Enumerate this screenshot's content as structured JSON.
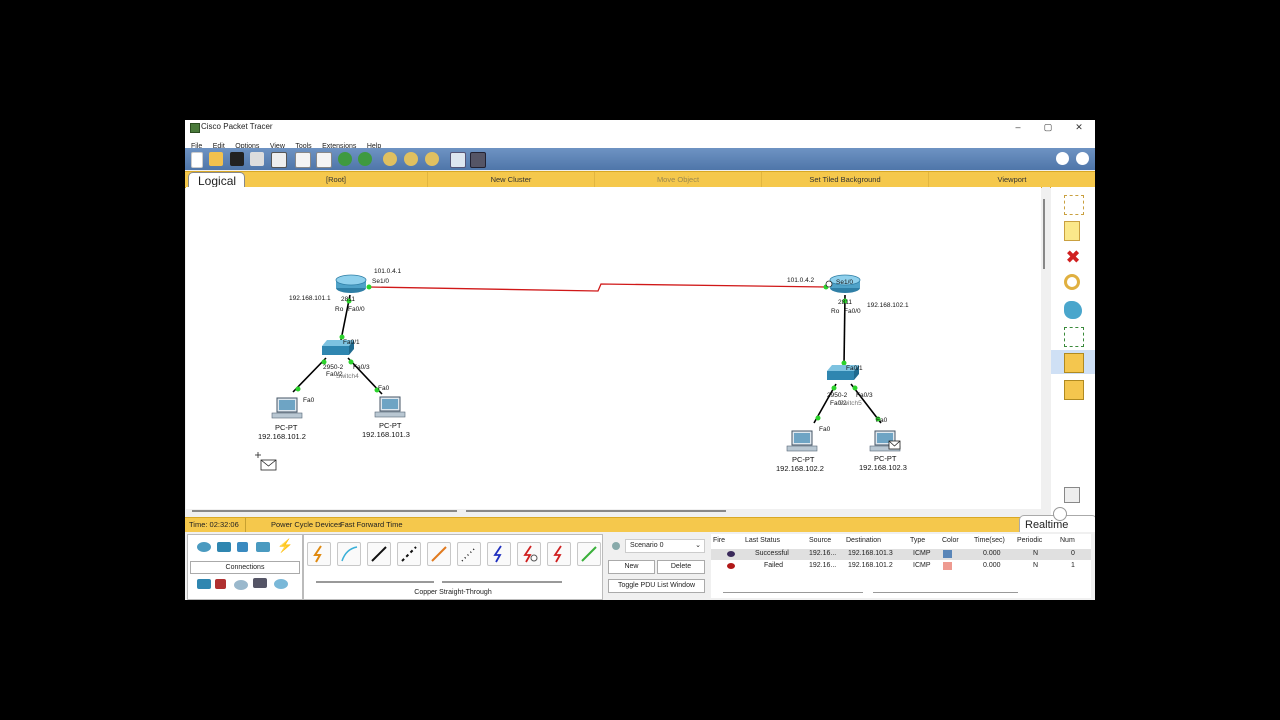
{
  "window": {
    "title": "Cisco Packet Tracer"
  },
  "menu": [
    "File",
    "Edit",
    "Options",
    "View",
    "Tools",
    "Extensions",
    "Help"
  ],
  "window_controls": {
    "minimize": "–",
    "maximize": "▢",
    "close": "✕"
  },
  "workspace": {
    "logical_tab": "Logical"
  },
  "nav": {
    "root": "[Root]",
    "new_cluster": "New Cluster",
    "move_object": "Move Object",
    "set_tiled_background": "Set Tiled Background",
    "viewport": "Viewport"
  },
  "topology": {
    "router1": {
      "model": "2811",
      "name_prefix": "Ro",
      "fa_label": "Fa0/0",
      "se_label": "Se1/0",
      "se_ip": "101.0.4.1",
      "lan_ip": "192.168.101.1"
    },
    "router2": {
      "model": "2811",
      "name_prefix": "Ro",
      "fa_label": "Fa0/0",
      "se_label": "Se1/0",
      "se_ip": "101.0.4.2",
      "lan_ip": "192.168.102.1"
    },
    "switch1": {
      "model": "2950-2",
      "port_up": "Fa0/1",
      "port_left": "Fa0/2",
      "port_right": "Fa0/3",
      "overlap": "Switch4"
    },
    "switch2": {
      "model": "2950-2",
      "port_up": "Fa0/1",
      "port_left": "Fa0/2",
      "port_right": "Fa0/3",
      "overlap": "Switch5"
    },
    "pcs": [
      {
        "type": "PC-PT",
        "ip": "192.168.101.2",
        "port": "Fa0"
      },
      {
        "type": "PC-PT",
        "ip": "192.168.101.3",
        "port": "Fa0"
      },
      {
        "type": "PC-PT",
        "ip": "192.168.102.2",
        "port": "Fa0"
      },
      {
        "type": "PC-PT",
        "ip": "192.168.102.3",
        "port": "Fa0"
      }
    ]
  },
  "status": {
    "time": "Time: 02:32:06",
    "power_cycle": "Power Cycle Devices",
    "fast_forward": "Fast Forward Time",
    "mode": "Realtime"
  },
  "devices": {
    "category_label": "Connections"
  },
  "cables": {
    "selected_name": "Copper Straight-Through"
  },
  "scenario": {
    "selected": "Scenario 0",
    "new": "New",
    "delete": "Delete",
    "toggle": "Toggle PDU List Window"
  },
  "pdu_table": {
    "headers": [
      "Fire",
      "Last Status",
      "Source",
      "Destination",
      "Type",
      "Color",
      "Time(sec)",
      "Periodic",
      "Num"
    ],
    "rows": [
      {
        "status": "Successful",
        "source": "192.16...",
        "destination": "192.168.101.3",
        "type": "ICMP",
        "color": "#5a86b8",
        "time": "0.000",
        "periodic": "N",
        "num": "0"
      },
      {
        "status": "Failed",
        "source": "192.16...",
        "destination": "192.168.101.2",
        "type": "ICMP",
        "color": "#ee9a90",
        "time": "0.000",
        "periodic": "N",
        "num": "1"
      }
    ]
  }
}
